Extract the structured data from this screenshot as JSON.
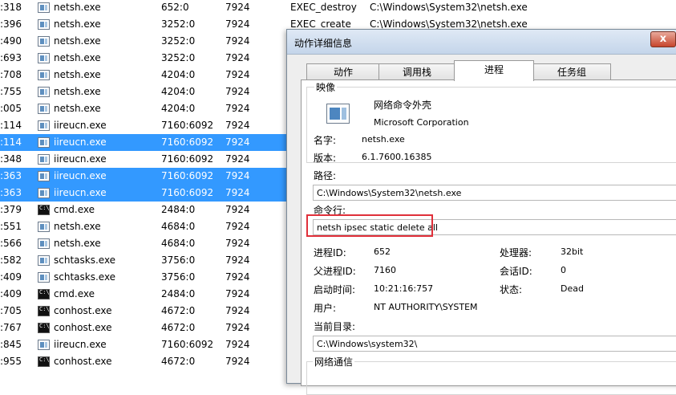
{
  "events": [
    {
      "seq": ":318",
      "icon": "exe",
      "name": "netsh.exe",
      "pid": "652:0",
      "x": "7924",
      "op": "EXEC_destroy",
      "path": "C:\\Windows\\System32\\netsh.exe",
      "selected": false
    },
    {
      "seq": ":396",
      "icon": "exe",
      "name": "netsh.exe",
      "pid": "3252:0",
      "x": "7924",
      "op": "EXEC_create",
      "path": "C:\\Windows\\System32\\netsh.exe",
      "selected": false
    },
    {
      "seq": ":490",
      "icon": "exe",
      "name": "netsh.exe",
      "pid": "3252:0",
      "x": "7924",
      "op": "",
      "path": "",
      "selected": false
    },
    {
      "seq": ":693",
      "icon": "exe",
      "name": "netsh.exe",
      "pid": "3252:0",
      "x": "7924",
      "op": "",
      "path": "",
      "selected": false
    },
    {
      "seq": ":708",
      "icon": "exe",
      "name": "netsh.exe",
      "pid": "4204:0",
      "x": "7924",
      "op": "",
      "path": "",
      "selected": false
    },
    {
      "seq": ":755",
      "icon": "exe",
      "name": "netsh.exe",
      "pid": "4204:0",
      "x": "7924",
      "op": "",
      "path": "",
      "selected": false
    },
    {
      "seq": ":005",
      "icon": "exe",
      "name": "netsh.exe",
      "pid": "4204:0",
      "x": "7924",
      "op": "",
      "path": "",
      "selected": false
    },
    {
      "seq": ":114",
      "icon": "exe",
      "name": "iireucn.exe",
      "pid": "7160:6092",
      "x": "7924",
      "op": "",
      "path": "",
      "selected": false
    },
    {
      "seq": ":114",
      "icon": "exe",
      "name": "iireucn.exe",
      "pid": "7160:6092",
      "x": "7924",
      "op": "",
      "path": "",
      "selected": true
    },
    {
      "seq": ":348",
      "icon": "exe",
      "name": "iireucn.exe",
      "pid": "7160:6092",
      "x": "7924",
      "op": "",
      "path": "",
      "selected": false
    },
    {
      "seq": ":363",
      "icon": "exe",
      "name": "iireucn.exe",
      "pid": "7160:6092",
      "x": "7924",
      "op": "",
      "path": "",
      "selected": true
    },
    {
      "seq": ":363",
      "icon": "exe",
      "name": "iireucn.exe",
      "pid": "7160:6092",
      "x": "7924",
      "op": "",
      "path": "",
      "selected": true
    },
    {
      "seq": ":379",
      "icon": "cmd",
      "name": "cmd.exe",
      "pid": "2484:0",
      "x": "7924",
      "op": "",
      "path": "",
      "selected": false
    },
    {
      "seq": ":551",
      "icon": "exe",
      "name": "netsh.exe",
      "pid": "4684:0",
      "x": "7924",
      "op": "",
      "path": "",
      "selected": false
    },
    {
      "seq": ":566",
      "icon": "exe",
      "name": "netsh.exe",
      "pid": "4684:0",
      "x": "7924",
      "op": "",
      "path": "",
      "selected": false
    },
    {
      "seq": ":582",
      "icon": "exe",
      "name": "schtasks.exe",
      "pid": "3756:0",
      "x": "7924",
      "op": "",
      "path": "",
      "selected": false
    },
    {
      "seq": ":409",
      "icon": "exe",
      "name": "schtasks.exe",
      "pid": "3756:0",
      "x": "7924",
      "op": "",
      "path": "",
      "selected": false
    },
    {
      "seq": ":409",
      "icon": "cmd",
      "name": "cmd.exe",
      "pid": "2484:0",
      "x": "7924",
      "op": "",
      "path": "",
      "selected": false
    },
    {
      "seq": ":705",
      "icon": "cmd",
      "name": "conhost.exe",
      "pid": "4672:0",
      "x": "7924",
      "op": "",
      "path": "",
      "selected": false
    },
    {
      "seq": ":767",
      "icon": "cmd",
      "name": "conhost.exe",
      "pid": "4672:0",
      "x": "7924",
      "op": "",
      "path": "",
      "selected": false
    },
    {
      "seq": ":845",
      "icon": "exe",
      "name": "iireucn.exe",
      "pid": "7160:6092",
      "x": "7924",
      "op": "",
      "path": "",
      "selected": false
    },
    {
      "seq": ":955",
      "icon": "cmd",
      "name": "conhost.exe",
      "pid": "4672:0",
      "x": "7924",
      "op": "",
      "path": "",
      "selected": false
    }
  ],
  "dialog": {
    "title": "动作详细信息",
    "close": "x",
    "tabs": [
      "动作",
      "调用栈",
      "进程",
      "任务组"
    ],
    "active_tab": 2,
    "image_group": "映像",
    "app_description": "网络命令外壳",
    "company": "Microsoft Corporation",
    "name_label": "名字:",
    "name_value": "netsh.exe",
    "version_label": "版本:",
    "version_value": "6.1.7600.16385",
    "path_label": "路径:",
    "path_value": "C:\\Windows\\System32\\netsh.exe",
    "cmdline_label": "命令行:",
    "cmdline_value": "netsh ipsec static delete all",
    "pid_label": "进程ID:",
    "pid_value": "652",
    "cpu_label": "处理器:",
    "cpu_value": "32bit",
    "ppid_label": "父进程ID:",
    "ppid_value": "7160",
    "session_label": "会话ID:",
    "session_value": "0",
    "start_label": "启动时间:",
    "start_value": "10:21:16:757",
    "state_label": "状态:",
    "state_value": "Dead",
    "user_label": "用户:",
    "user_value": "NT AUTHORITY\\SYSTEM",
    "cwd_label": "当前目录:",
    "cwd_value": "C:\\Windows\\system32\\",
    "network_group": "网络通信"
  },
  "colors": {
    "selection": "#3399ff",
    "highlight_box": "#e0303a"
  }
}
